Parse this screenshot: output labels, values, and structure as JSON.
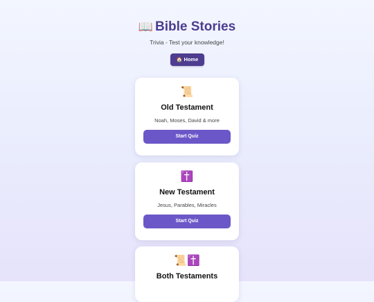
{
  "header": {
    "title_icon": "📖",
    "title": "Bible Stories",
    "subtitle": "Trivia - Test your knowledge!",
    "home_icon": "🏠",
    "home_label": "Home"
  },
  "cards": [
    {
      "icon": "📜",
      "title": "Old Testament",
      "description": "Noah, Moses, David & more",
      "button_label": "Start Quiz"
    },
    {
      "icon": "✝️",
      "title": "New Testament",
      "description": "Jesus, Parables, Miracles",
      "button_label": "Start Quiz"
    },
    {
      "icon": "📜✝️",
      "title": "Both Testaments"
    }
  ],
  "colors": {
    "title": "#4b3d8f",
    "home_button": "#4d3c8f",
    "start_button": "#6c57c8",
    "card_background": "#ffffff"
  }
}
